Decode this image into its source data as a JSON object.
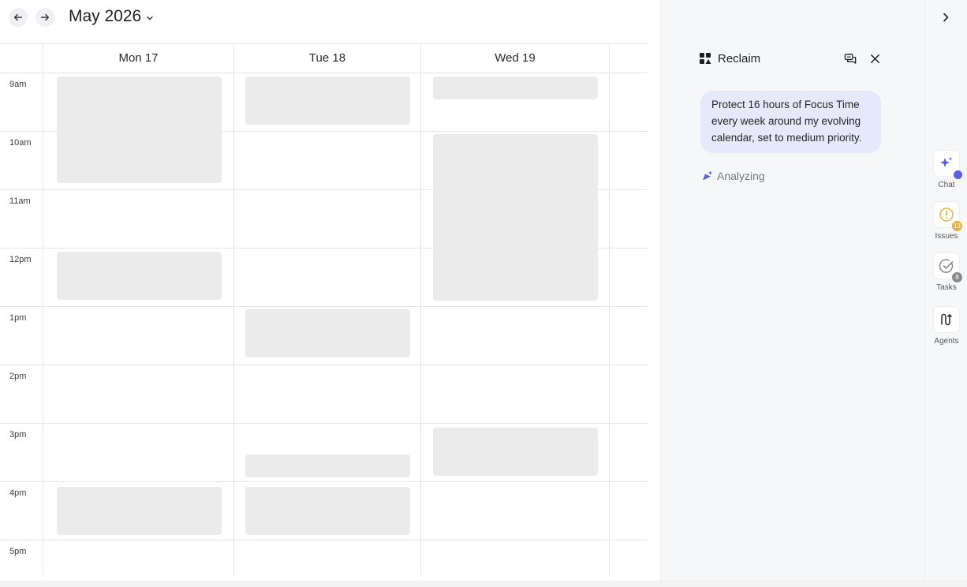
{
  "calendar": {
    "month_title": "May 2026",
    "days": [
      {
        "label": "Mon 17"
      },
      {
        "label": "Tue 18"
      },
      {
        "label": "Wed 19"
      }
    ],
    "times": [
      "9am",
      "10am",
      "11am",
      "12pm",
      "1pm",
      "2pm",
      "3pm",
      "4pm",
      "5pm"
    ]
  },
  "panel": {
    "brand_name": "Reclaim",
    "user_message": "Protect 16 hours of Focus Time every week around my evolving calendar, set to medium priority.",
    "status_text": "Analyzing"
  },
  "rail": {
    "items": [
      {
        "label": "Chat",
        "icon": "sparkle-icon"
      },
      {
        "label": "Issues",
        "icon": "warning-icon",
        "badge": "13"
      },
      {
        "label": "Tasks",
        "icon": "check-circle-icon",
        "badge": "8"
      },
      {
        "label": "Agents",
        "icon": "agents-icon"
      }
    ]
  },
  "colors": {
    "accent": "#5b5fe8",
    "bubble": "#e5e9fb",
    "issues_badge": "#e8b33c",
    "tasks_badge": "#8a8a8a",
    "event_placeholder": "#ebebeb"
  }
}
